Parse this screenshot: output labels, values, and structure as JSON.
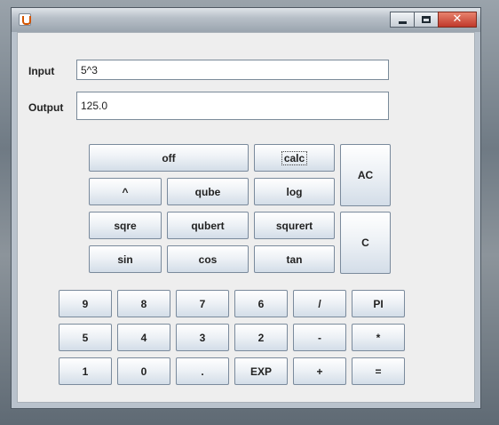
{
  "window": {
    "title": ""
  },
  "inputs": {
    "input_label": "Input",
    "input_value": "5^3",
    "output_label": "Output",
    "output_value": "125.0"
  },
  "function_buttons": {
    "off": "off",
    "calc": "calc",
    "ac": "AC",
    "power": "^",
    "qube": "qube",
    "log": "log",
    "sqre": "sqre",
    "qubert": "qubert",
    "squrert": "squrert",
    "c": "C",
    "sin": "sin",
    "cos": "cos",
    "tan": "tan"
  },
  "keypad": {
    "k9": "9",
    "k8": "8",
    "k7": "7",
    "k6": "6",
    "div": "/",
    "pi": "PI",
    "k5": "5",
    "k4": "4",
    "k3": "3",
    "k2": "2",
    "minus": "-",
    "mul": "*",
    "k1": "1",
    "k0": "0",
    "dot": ".",
    "exp": "EXP",
    "plus": "+",
    "eq": "="
  }
}
